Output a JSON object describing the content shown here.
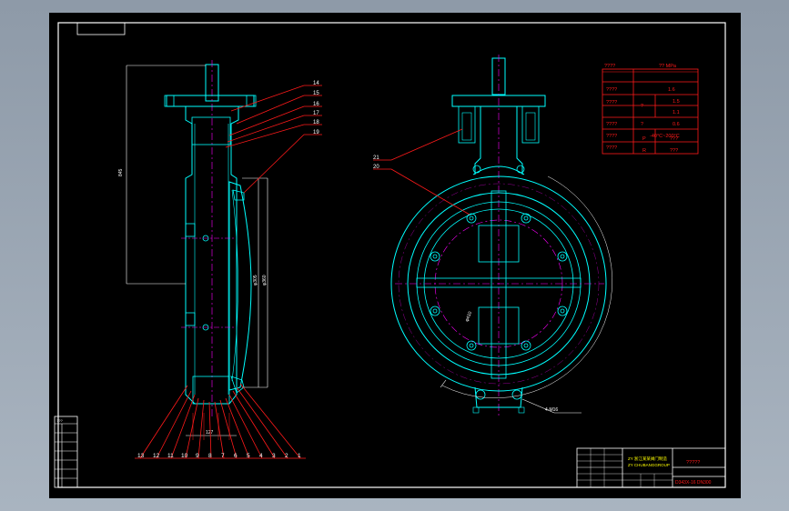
{
  "title_block": {
    "company_lines": [
      "ZY 浙江某某阀门制造",
      "ZY CHUBANGGROUP"
    ],
    "drawing_name": "?????",
    "drawing_code": "D343X-16 DN300"
  },
  "spec_table": {
    "header_left": "????",
    "header_right": "??  MPa",
    "rows": [
      {
        "label": "????",
        "sub": "",
        "value": "1.6"
      },
      {
        "label": "????",
        "sub": "?",
        "value": "1.5"
      },
      {
        "label": "",
        "sub": "",
        "value": "1.1"
      },
      {
        "label": "????",
        "sub": "?",
        "value": "0.6"
      },
      {
        "label": "????",
        "sub": "",
        "value": "-40°C~200°C"
      },
      {
        "label": "????",
        "sub": "P",
        "value": "???"
      },
      {
        "label": "",
        "sub": "R",
        "value": "???"
      }
    ]
  },
  "balloons_side": [
    "14",
    "15",
    "16",
    "17",
    "18",
    "19"
  ],
  "balloons_front": [
    "21",
    "20"
  ],
  "balloons_bottom": [
    "13",
    "12",
    "11",
    "10",
    "9",
    "8",
    "7",
    "6",
    "5",
    "4",
    "3",
    "2",
    "1"
  ],
  "dimensions": {
    "overall_height": "845",
    "bore": "φ305",
    "flange": "φ360",
    "pcd": "φ410",
    "face_width": "127",
    "bolt_holes": "4-M16"
  },
  "revision_block": {
    "label": "???"
  },
  "colors": {
    "red": "#ff1a1a",
    "cyan": "#00ffff",
    "magenta": "#ff00ff",
    "white": "#ffffff",
    "yellow": "#ffff00"
  }
}
